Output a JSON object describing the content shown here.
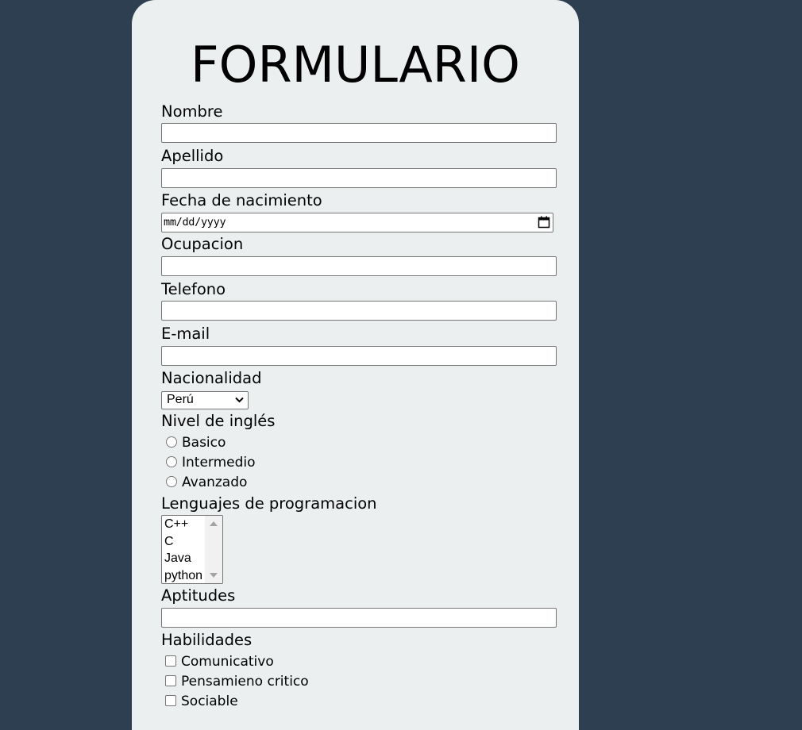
{
  "form": {
    "title": "FORMULARIO",
    "fields": {
      "nombre": {
        "label": "Nombre",
        "value": ""
      },
      "apellido": {
        "label": "Apellido",
        "value": ""
      },
      "fecha": {
        "label": "Fecha de nacimiento",
        "placeholder": "mm/dd/yyyy"
      },
      "ocupacion": {
        "label": "Ocupacion",
        "value": ""
      },
      "telefono": {
        "label": "Telefono",
        "value": ""
      },
      "email": {
        "label": "E-mail",
        "value": ""
      },
      "nacionalidad": {
        "label": "Nacionalidad",
        "selected": "Perú"
      },
      "ingles": {
        "label": "Nivel de inglés",
        "options": [
          "Basico",
          "Intermedio",
          "Avanzado"
        ]
      },
      "lenguajes": {
        "label": "Lenguajes de programacion",
        "options": [
          "C++",
          "C",
          "Java",
          "python"
        ]
      },
      "aptitudes": {
        "label": "Aptitudes",
        "value": ""
      },
      "habilidades": {
        "label": "Habilidades",
        "options": [
          "Comunicativo",
          "Pensamieno critico",
          "Sociable"
        ]
      }
    }
  },
  "colors": {
    "background": "#2e3f51",
    "card": "#ebeff0"
  },
  "icons": {
    "date_picker": "calendar-icon",
    "select": "chevron-down-icon",
    "listbox_scroll_up": "triangle-up-icon",
    "listbox_scroll_down": "triangle-down-icon"
  }
}
